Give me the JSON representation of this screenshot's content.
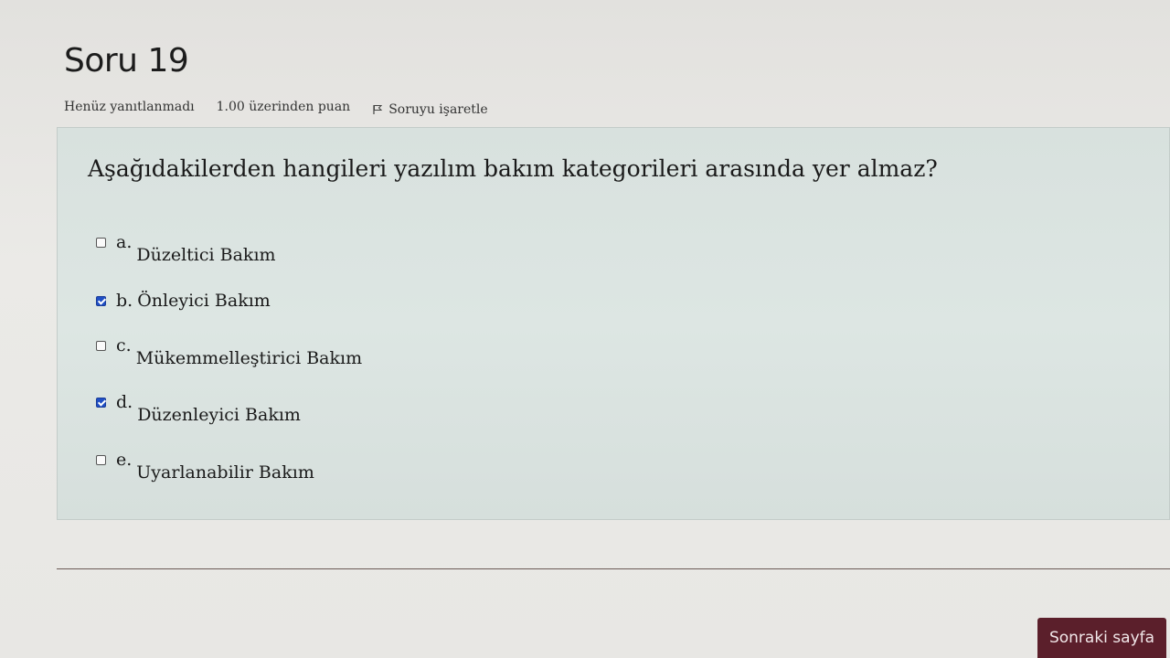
{
  "question": {
    "title": "Soru 19",
    "status": "Henüz yanıtlanmadı",
    "points": "1.00 üzerinden puan",
    "flag_label": "Soruyu işaretle",
    "text": "Aşağıdakilerden hangileri yazılım bakım kategorileri arasında yer almaz?"
  },
  "answers": [
    {
      "letter": "a.",
      "text": "Düzeltici Bakım",
      "checked": false
    },
    {
      "letter": "b.",
      "text": "Önleyici Bakım",
      "checked": true
    },
    {
      "letter": "c.",
      "text": "Mükemmelleştirici Bakım",
      "checked": false
    },
    {
      "letter": "d.",
      "text": "Düzenleyici Bakım",
      "checked": true
    },
    {
      "letter": "e.",
      "text": "Uyarlanabilir Bakım",
      "checked": false
    }
  ],
  "navigation": {
    "next_label": "Sonraki sayfa"
  },
  "colors": {
    "question_bg": "#dbe3e0",
    "checkbox_checked": "#1f4fc4",
    "next_button": "#5b1f2b"
  }
}
